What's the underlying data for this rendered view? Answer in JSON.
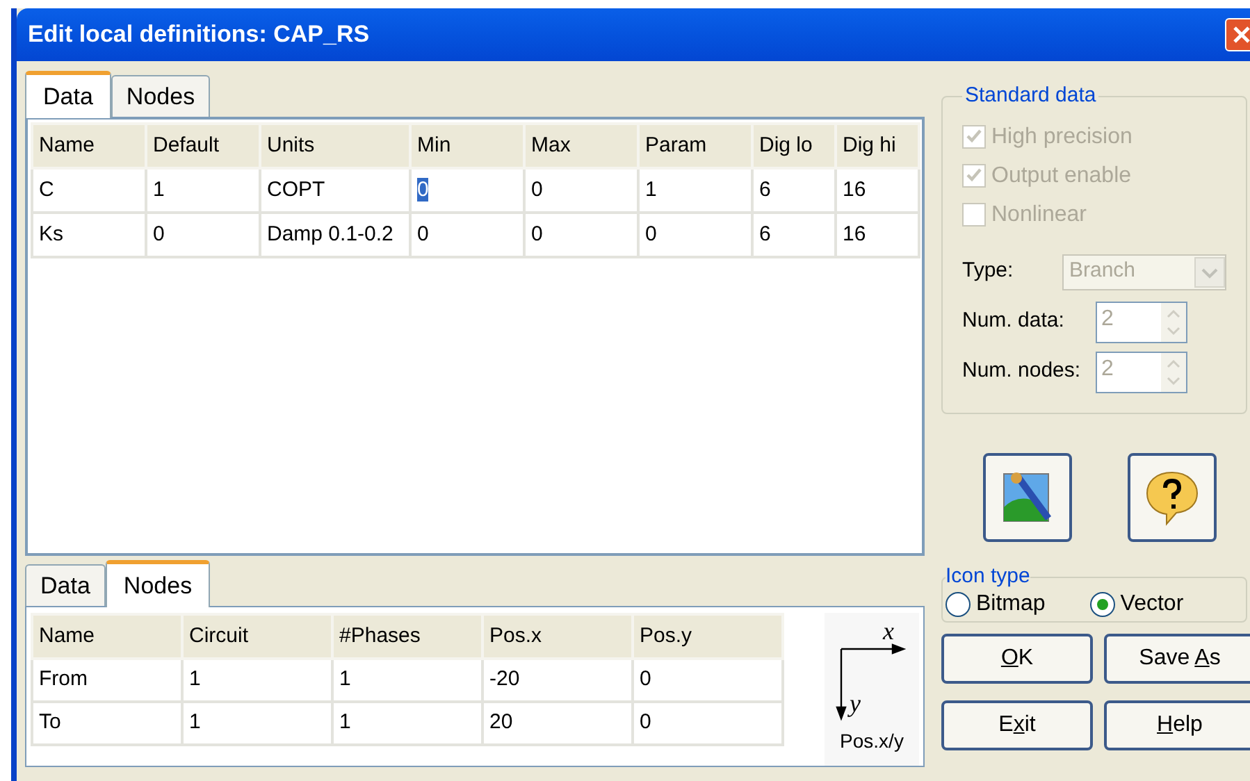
{
  "window": {
    "title": "Edit local definitions: CAP_RS"
  },
  "upper_tabs": [
    {
      "label": "Data",
      "selected": true
    },
    {
      "label": "Nodes",
      "selected": false
    }
  ],
  "data_table": {
    "columns": [
      "Name",
      "Default",
      "Units",
      "Min",
      "Max",
      "Param",
      "Dig lo",
      "Dig hi"
    ],
    "rows": [
      [
        {
          "text": "C",
          "selected": false
        },
        {
          "text": "1",
          "selected": false
        },
        {
          "text": "COPT",
          "selected": false
        },
        {
          "text": "0",
          "selected": true
        },
        {
          "text": "0",
          "selected": false
        },
        {
          "text": "1",
          "selected": false
        },
        {
          "text": "6",
          "selected": false
        },
        {
          "text": "16",
          "selected": false
        }
      ],
      [
        {
          "text": "Ks",
          "selected": false
        },
        {
          "text": "0",
          "selected": false
        },
        {
          "text": "Damp 0.1-0.2",
          "selected": false
        },
        {
          "text": "0",
          "selected": false
        },
        {
          "text": "0",
          "selected": false
        },
        {
          "text": "0",
          "selected": false
        },
        {
          "text": "6",
          "selected": false
        },
        {
          "text": "16",
          "selected": false
        }
      ]
    ]
  },
  "lower_tabs": [
    {
      "label": "Data",
      "selected": false
    },
    {
      "label": "Nodes",
      "selected": true
    }
  ],
  "nodes_table": {
    "columns": [
      "Name",
      "Circuit",
      "#Phases",
      "Pos.x",
      "Pos.y"
    ],
    "rows": [
      [
        "From",
        "1",
        "1",
        "-20",
        "0"
      ],
      [
        "To",
        "1",
        "1",
        "20",
        "0"
      ]
    ]
  },
  "axes": {
    "x_label": "x",
    "y_label": "y",
    "caption": "Pos.x/y"
  },
  "standard_data": {
    "title": "Standard data",
    "checkboxes": [
      {
        "label": "High precision",
        "checked": true,
        "disabled": true
      },
      {
        "label": "Output enable",
        "checked": true,
        "disabled": true
      },
      {
        "label": "Nonlinear",
        "checked": false,
        "disabled": true
      }
    ],
    "type": {
      "label": "Type:",
      "value": "Branch",
      "disabled": true
    },
    "spinners": [
      {
        "label": "Num. data:",
        "value": "2",
        "disabled": true
      },
      {
        "label": "Num. nodes:",
        "value": "2",
        "disabled": true
      }
    ]
  },
  "icon_buttons": [
    {
      "kind": "picture"
    },
    {
      "kind": "help"
    }
  ],
  "icon_type": {
    "title": "Icon type",
    "options": [
      {
        "label": "Bitmap",
        "selected": false
      },
      {
        "label": "Vector",
        "selected": true
      }
    ]
  },
  "buttons": [
    {
      "key": "O",
      "after": "K"
    },
    {
      "before": "Save ",
      "key": "A",
      "after": "s"
    },
    {
      "before": "E",
      "key": "x",
      "after": "it"
    },
    {
      "key": "H",
      "after": "elp"
    }
  ]
}
